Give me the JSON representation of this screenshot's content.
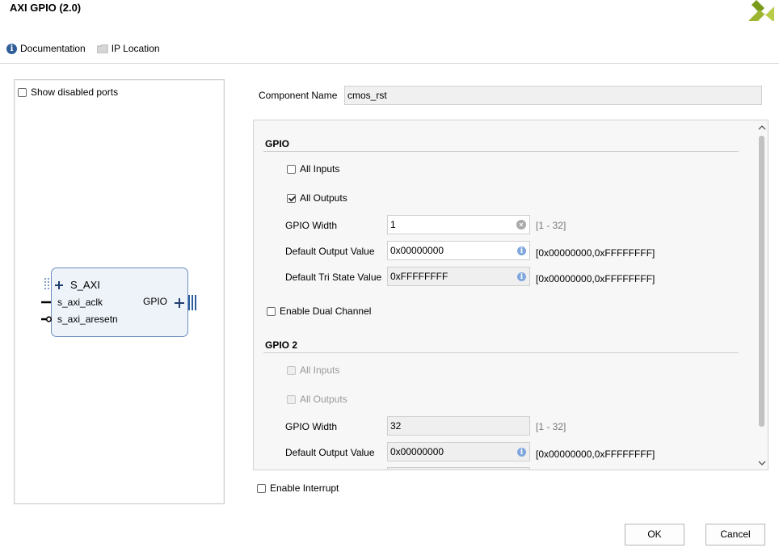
{
  "window": {
    "title": "AXI GPIO (2.0)"
  },
  "toolbar": {
    "items": [
      {
        "label": "Documentation",
        "icon": "info-icon"
      },
      {
        "label": "IP Location",
        "icon": "folder-icon"
      }
    ]
  },
  "left_panel": {
    "show_disabled_ports": {
      "label": "Show disabled ports",
      "checked": false
    },
    "block": {
      "interface_in": "S_AXI",
      "ports_in": [
        "s_axi_aclk",
        "s_axi_aresetn"
      ],
      "interface_out": "GPIO"
    }
  },
  "component": {
    "label": "Component Name",
    "value": "cmos_rst"
  },
  "gpio": {
    "title": "GPIO",
    "all_inputs": {
      "label": "All Inputs",
      "checked": false
    },
    "all_outputs": {
      "label": "All Outputs",
      "checked": true
    },
    "width": {
      "label": "GPIO Width",
      "value": "1",
      "range": "[1 - 32]"
    },
    "default_output": {
      "label": "Default Output Value",
      "value": "0x00000000",
      "range": "[0x00000000,0xFFFFFFFF]"
    },
    "default_tri": {
      "label": "Default Tri State Value",
      "value": "0xFFFFFFFF",
      "range": "[0x00000000,0xFFFFFFFF]"
    }
  },
  "dual_channel": {
    "label": "Enable Dual Channel",
    "checked": false
  },
  "gpio2": {
    "title": "GPIO 2",
    "all_inputs": {
      "label": "All Inputs",
      "checked": false
    },
    "all_outputs": {
      "label": "All Outputs",
      "checked": false
    },
    "width": {
      "label": "GPIO Width",
      "value": "32",
      "range": "[1 - 32]"
    },
    "default_output": {
      "label": "Default Output Value",
      "value": "0x00000000",
      "range": "[0x00000000,0xFFFFFFFF]"
    }
  },
  "interrupt": {
    "label": "Enable Interrupt",
    "checked": false
  },
  "buttons": {
    "ok": "OK",
    "cancel": "Cancel"
  },
  "colors": {
    "accent": "#2f5e99",
    "logo": "#9cb631",
    "block_border": "#6c8fbf"
  }
}
